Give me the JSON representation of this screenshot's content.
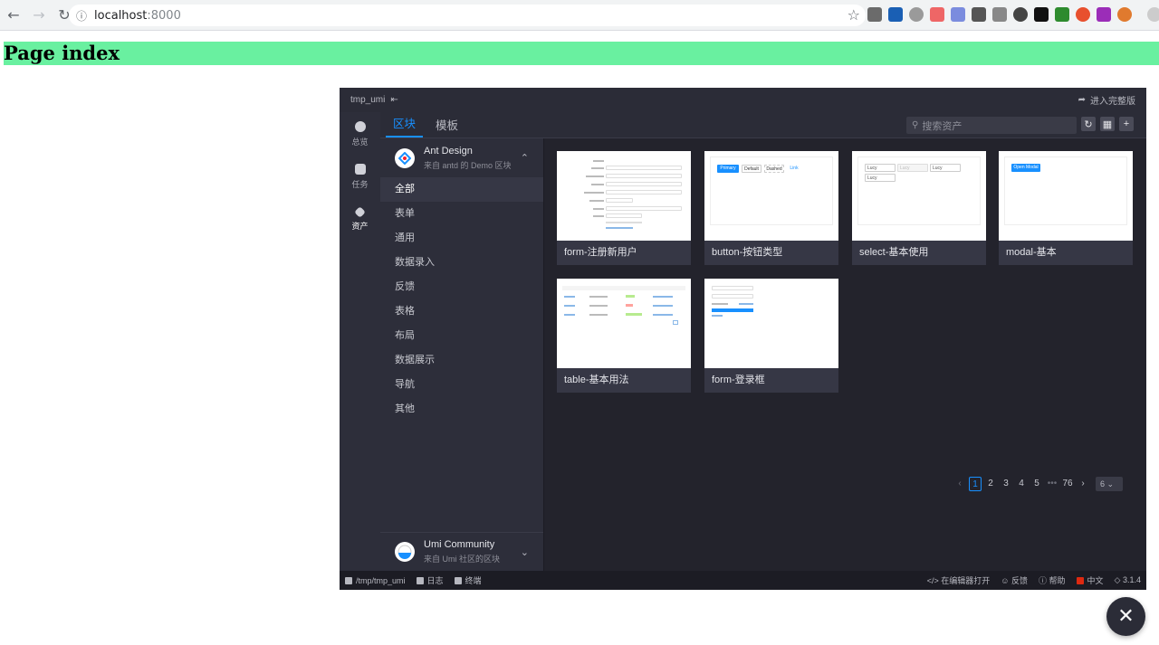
{
  "browser": {
    "url_host": "localhost",
    "url_port": ":8000"
  },
  "page": {
    "heading": "Page index"
  },
  "ui": {
    "project": "tmp_umi",
    "enter_full": "进入完整版",
    "left_nav": [
      {
        "label": "总览",
        "icon": "dashboard-icon"
      },
      {
        "label": "任务",
        "icon": "task-icon"
      },
      {
        "label": "资产",
        "icon": "layers-icon"
      }
    ],
    "tabs": [
      {
        "label": "区块"
      },
      {
        "label": "模板"
      }
    ],
    "search_placeholder": "搜索资产",
    "libraries": {
      "top": {
        "name": "Ant Design",
        "sub": "来自 antd 的 Demo 区块"
      },
      "bottom": {
        "name": "Umi Community",
        "sub": "来自 Umi 社区的区块"
      }
    },
    "categories": [
      {
        "label": "全部"
      },
      {
        "label": "表单"
      },
      {
        "label": "通用"
      },
      {
        "label": "数据录入"
      },
      {
        "label": "反馈"
      },
      {
        "label": "表格"
      },
      {
        "label": "布局"
      },
      {
        "label": "数据展示"
      },
      {
        "label": "导航"
      },
      {
        "label": "其他"
      }
    ],
    "cards": [
      {
        "label": "form-注册新用户"
      },
      {
        "label": "button-按钮类型"
      },
      {
        "label": "select-基本使用"
      },
      {
        "label": "modal-基本"
      },
      {
        "label": "table-基本用法"
      },
      {
        "label": "form-登录框"
      }
    ],
    "thumb_text": {
      "primary": "Primary",
      "default": "Default",
      "dashed": "Dashed",
      "link": "Link",
      "open_modal": "Open Modal",
      "lucy": "Lucy"
    },
    "pagination": {
      "pages": [
        "1",
        "2",
        "3",
        "4",
        "5",
        "•••",
        "76"
      ],
      "size": "6"
    },
    "status": {
      "path": "/tmp/tmp_umi",
      "log": "日志",
      "terminal": "终端",
      "open_editor": "在编辑器打开",
      "feedback": "反馈",
      "help": "帮助",
      "lang": "中文",
      "version": "3.1.4"
    },
    "accent": "#1890ff"
  }
}
